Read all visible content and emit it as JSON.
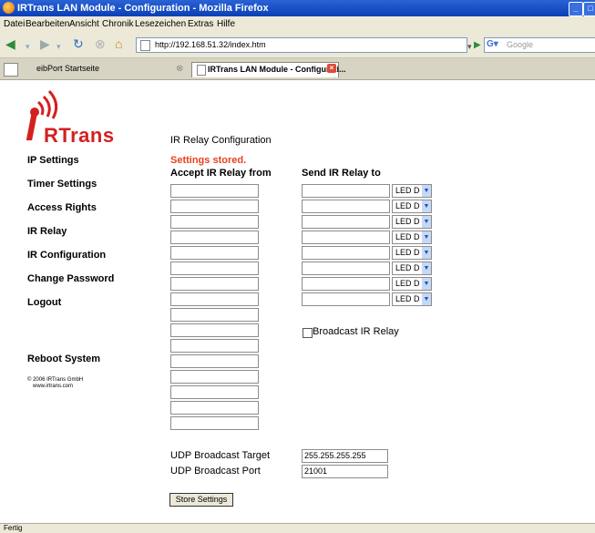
{
  "window": {
    "title": "IRTrans LAN Module - Configuration - Mozilla Firefox"
  },
  "menu": {
    "items": [
      "Datei",
      "Bearbeiten",
      "Ansicht",
      "Chronik",
      "Lesezeichen",
      "Extras",
      "Hilfe"
    ]
  },
  "nav": {
    "url": "http://192.168.51.32/index.htm",
    "search_placeholder": "Google"
  },
  "tabs": [
    {
      "label": "eibPort Startseite"
    },
    {
      "label": "IRTrans LAN Module - Configurati..."
    }
  ],
  "logo": {
    "text": "RTrans"
  },
  "sidebar": {
    "items": [
      "IP Settings",
      "Timer Settings",
      "Access Rights",
      "IR Relay",
      "IR Configuration",
      "Change Password",
      "Logout"
    ],
    "reboot": "Reboot System",
    "copyright": "© 2006 IRTrans GmbH",
    "website": "www.irtrans.com"
  },
  "page": {
    "heading": "IR Relay Configuration",
    "status": "Settings stored.",
    "col_accept": "Accept IR Relay from",
    "col_send": "Send IR Relay to",
    "led_option": "LED D",
    "broadcast_relay": "Broadcast IR Relay",
    "udp_target_label": "UDP Broadcast Target",
    "udp_target_value": "255.255.255.255",
    "udp_port_label": "UDP Broadcast Port",
    "udp_port_value": "21001",
    "store_button": "Store Settings"
  },
  "status_bar": {
    "text": "Fertig"
  },
  "colors": {
    "status_red": "#e8401e",
    "logo_red": "#d42020"
  }
}
